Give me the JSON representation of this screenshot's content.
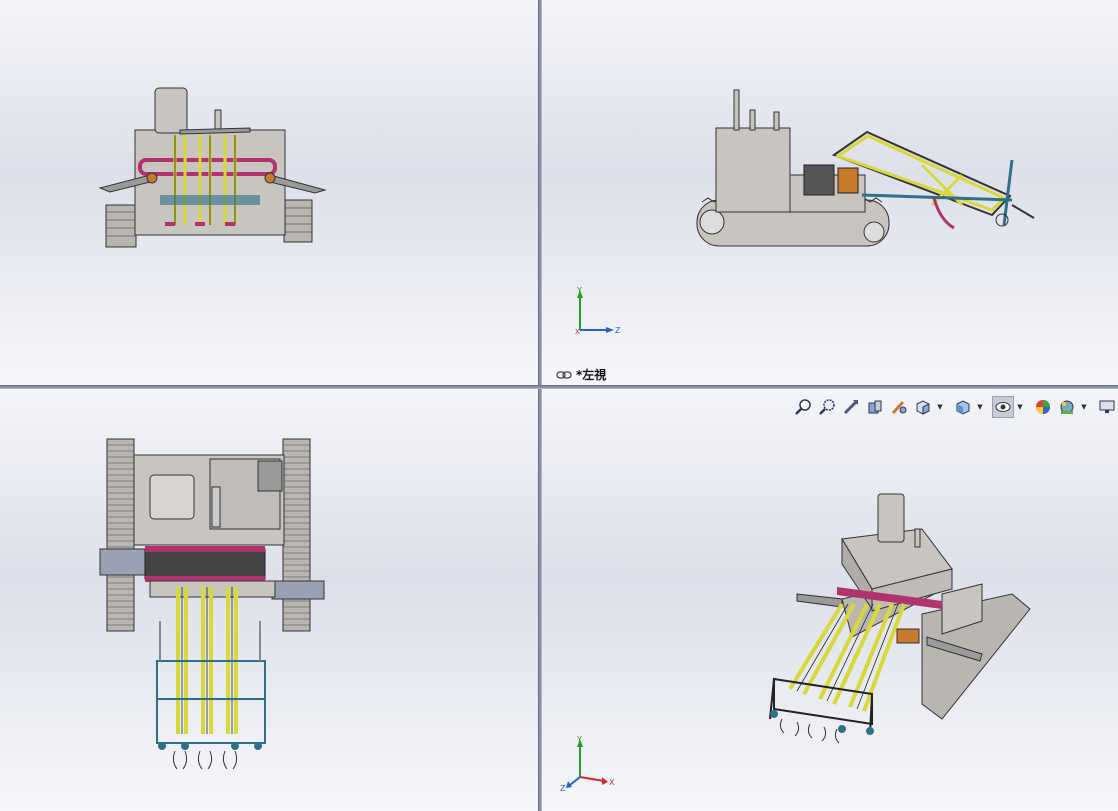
{
  "viewports": {
    "top_right": {
      "view_label": "*左視",
      "triad": {
        "y": "Y",
        "x": "X",
        "z": "Z"
      }
    },
    "bottom_right": {
      "triad": {
        "y": "Y",
        "x": "X",
        "z": "Z"
      }
    }
  },
  "heads_up_toolbar": {
    "buttons": [
      {
        "name": "zoom-to-fit-icon"
      },
      {
        "name": "zoom-to-area-icon"
      },
      {
        "name": "previous-view-icon"
      },
      {
        "name": "section-view-icon"
      },
      {
        "name": "dynamic-annotation-view-icon"
      },
      {
        "name": "view-orientation-icon",
        "dropdown": true
      },
      {
        "name": "display-style-icon",
        "dropdown": true
      },
      {
        "name": "hide-show-items-icon",
        "dropdown": true,
        "active": true
      },
      {
        "name": "edit-appearance-icon"
      },
      {
        "name": "apply-scene-icon",
        "dropdown": true
      },
      {
        "name": "view-setting-icon"
      }
    ]
  },
  "colors": {
    "body_gray": "#c8c4c0",
    "track_gray": "#b9b6b2",
    "frame_yellow": "#d8d83a",
    "chain_magenta": "#b0336e",
    "frame_teal": "#2f6f88",
    "accent_orange": "#c87a2c"
  }
}
